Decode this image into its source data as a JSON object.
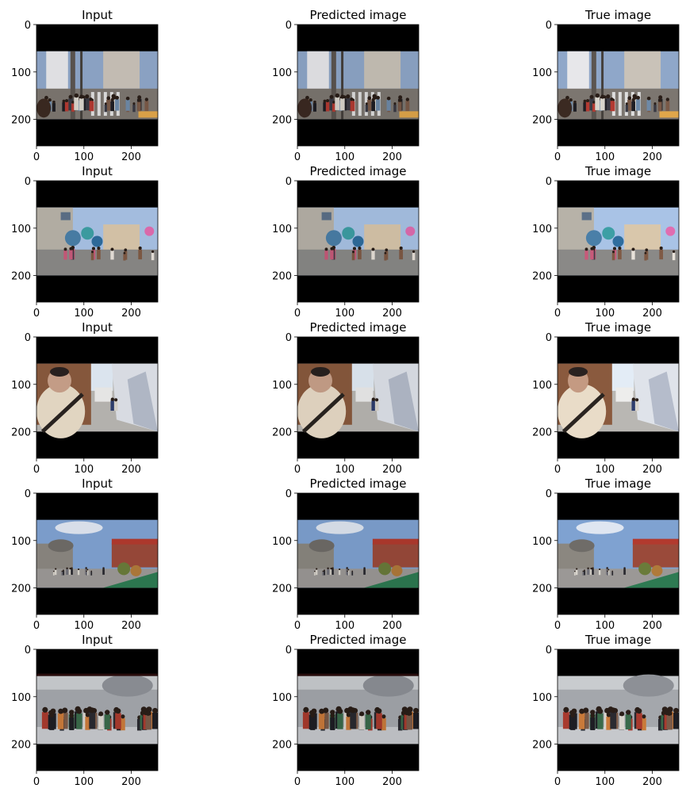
{
  "figure": {
    "panels": [
      {
        "title": "Input",
        "scene": "street-crossing",
        "variant": "input"
      },
      {
        "title": "Predicted image",
        "scene": "street-crossing",
        "variant": "predicted"
      },
      {
        "title": "True image",
        "scene": "street-crossing",
        "variant": "true"
      },
      {
        "title": "Input",
        "scene": "plaza-balloons",
        "variant": "input"
      },
      {
        "title": "Predicted image",
        "scene": "plaza-balloons",
        "variant": "predicted"
      },
      {
        "title": "True image",
        "scene": "plaza-balloons",
        "variant": "true"
      },
      {
        "title": "Input",
        "scene": "alley-man",
        "variant": "input"
      },
      {
        "title": "Predicted image",
        "scene": "alley-man",
        "variant": "predicted"
      },
      {
        "title": "True image",
        "scene": "alley-man",
        "variant": "true"
      },
      {
        "title": "Input",
        "scene": "themepark-street",
        "variant": "input"
      },
      {
        "title": "Predicted image",
        "scene": "themepark-street",
        "variant": "predicted"
      },
      {
        "title": "True image",
        "scene": "themepark-street",
        "variant": "true"
      },
      {
        "title": "Input",
        "scene": "crowd-walkway",
        "variant": "input"
      },
      {
        "title": "Predicted image",
        "scene": "crowd-walkway",
        "variant": "predicted"
      },
      {
        "title": "True image",
        "scene": "crowd-walkway",
        "variant": "true"
      }
    ],
    "x_ticks": [
      "0",
      "100",
      "200"
    ],
    "y_ticks": [
      "0",
      "100",
      "200"
    ],
    "axis_range": [
      0,
      256
    ],
    "colors": {
      "axes": "#000000",
      "letterbox": "#000000"
    }
  }
}
